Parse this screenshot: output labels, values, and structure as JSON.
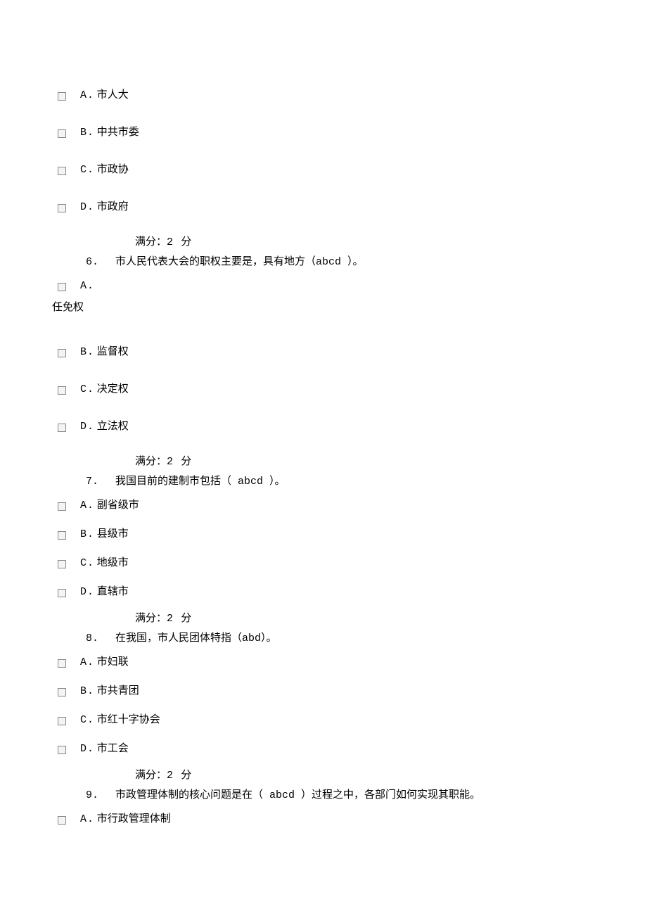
{
  "q5": {
    "opts": [
      {
        "letter": "A.",
        "text": "市人大"
      },
      {
        "letter": "B.",
        "text": "中共市委"
      },
      {
        "letter": "C.",
        "text": "市政协"
      },
      {
        "letter": "D.",
        "text": "市政府"
      }
    ]
  },
  "score": {
    "label_a": "满分：",
    "value": "2",
    "label_b": "分"
  },
  "q6": {
    "num": "6.",
    "text_a": "市人民代表大会的职权主要是，具有地方（",
    "ans": "abcd ",
    "text_b": "）。",
    "optA": {
      "letter": "A.",
      "standalone": "任免权"
    },
    "opts": [
      {
        "letter": "B.",
        "text": "监督权"
      },
      {
        "letter": "C.",
        "text": "决定权"
      },
      {
        "letter": "D.",
        "text": "立法权"
      }
    ]
  },
  "q7": {
    "num": "7.",
    "text_a": "我国目前的建制市包括（",
    "ans": " abcd ",
    "text_b": "）。",
    "opts": [
      {
        "letter": "A.",
        "text": "副省级市"
      },
      {
        "letter": "B.",
        "text": "县级市"
      },
      {
        "letter": "C.",
        "text": "地级市"
      },
      {
        "letter": "D.",
        "text": "直辖市"
      }
    ]
  },
  "q8": {
    "num": "8.",
    "text_a": "在我国，市人民团体特指（",
    "ans": "abd",
    "text_b": "）。",
    "opts": [
      {
        "letter": "A.",
        "text": "市妇联"
      },
      {
        "letter": "B.",
        "text": "市共青团"
      },
      {
        "letter": "C.",
        "text": "市红十字协会"
      },
      {
        "letter": "D.",
        "text": "市工会"
      }
    ]
  },
  "q9": {
    "num": "9.",
    "text_a": "市政管理体制的核心问题是在（",
    "ans": " abcd  ",
    "text_b": "）过程之中，各部门如何实现其职能。",
    "opts": [
      {
        "letter": "A.",
        "text": "市行政管理体制"
      }
    ]
  }
}
